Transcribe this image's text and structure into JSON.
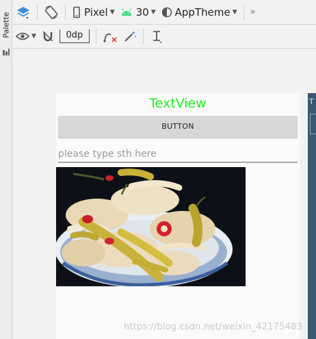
{
  "palette": {
    "label": "Palette"
  },
  "toolbar1": {
    "device": "Pixel",
    "api_level": "30",
    "theme": "AppTheme",
    "overflow": "»"
  },
  "toolbar2": {
    "default_margin": "0dp"
  },
  "layout": {
    "textview_text": "TextView",
    "button_text": "BUTTON",
    "edittext_hint": "please type sth here",
    "textview_color": "#1ef01e"
  },
  "side_panel": {
    "header": "T"
  },
  "watermark": "https://blog.csdn.net/weixin_42175483"
}
